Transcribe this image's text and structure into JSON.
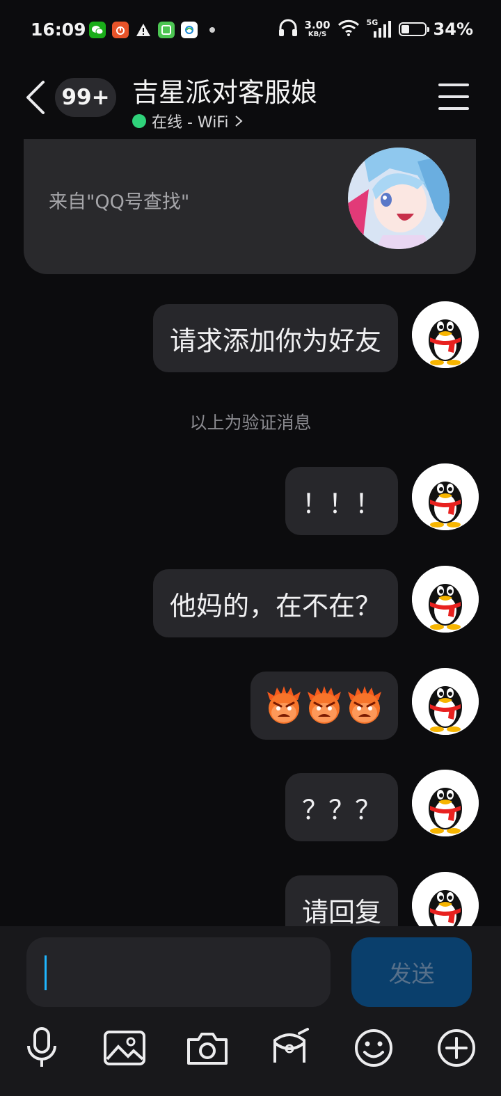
{
  "status_bar": {
    "time": "16:09",
    "net_speed_value": "3.00",
    "net_speed_unit": "KB/S",
    "signal_label": "5G",
    "battery_percent": "34%",
    "battery_level": 0.34,
    "app_icons": [
      "wechat-icon",
      "music-app-icon",
      "warning-icon",
      "green-app-icon",
      "mobile-carrier-icon",
      "more-dot-icon"
    ]
  },
  "header": {
    "unread_badge": "99+",
    "title": "吉星派对客服娘",
    "status": "在线 - WiFi",
    "status_color": "#2fd27a"
  },
  "card": {
    "source_text": "来自\"QQ号查找\""
  },
  "messages": [
    {
      "text": "请求添加你为好友"
    },
    {
      "text": "！！！"
    },
    {
      "text": "他妈的，在不在？"
    },
    {
      "emoji": "angry-face-emoji",
      "count": 3
    },
    {
      "text": "？？？"
    },
    {
      "text": "请回复"
    }
  ],
  "system_message": "以上为验证消息",
  "composer": {
    "send_label": "发送",
    "send_color": "#0a3f6c"
  },
  "toolbar": [
    "microphone-icon",
    "image-icon",
    "camera-icon",
    "red-packet-icon",
    "emoji-icon",
    "plus-icon"
  ]
}
